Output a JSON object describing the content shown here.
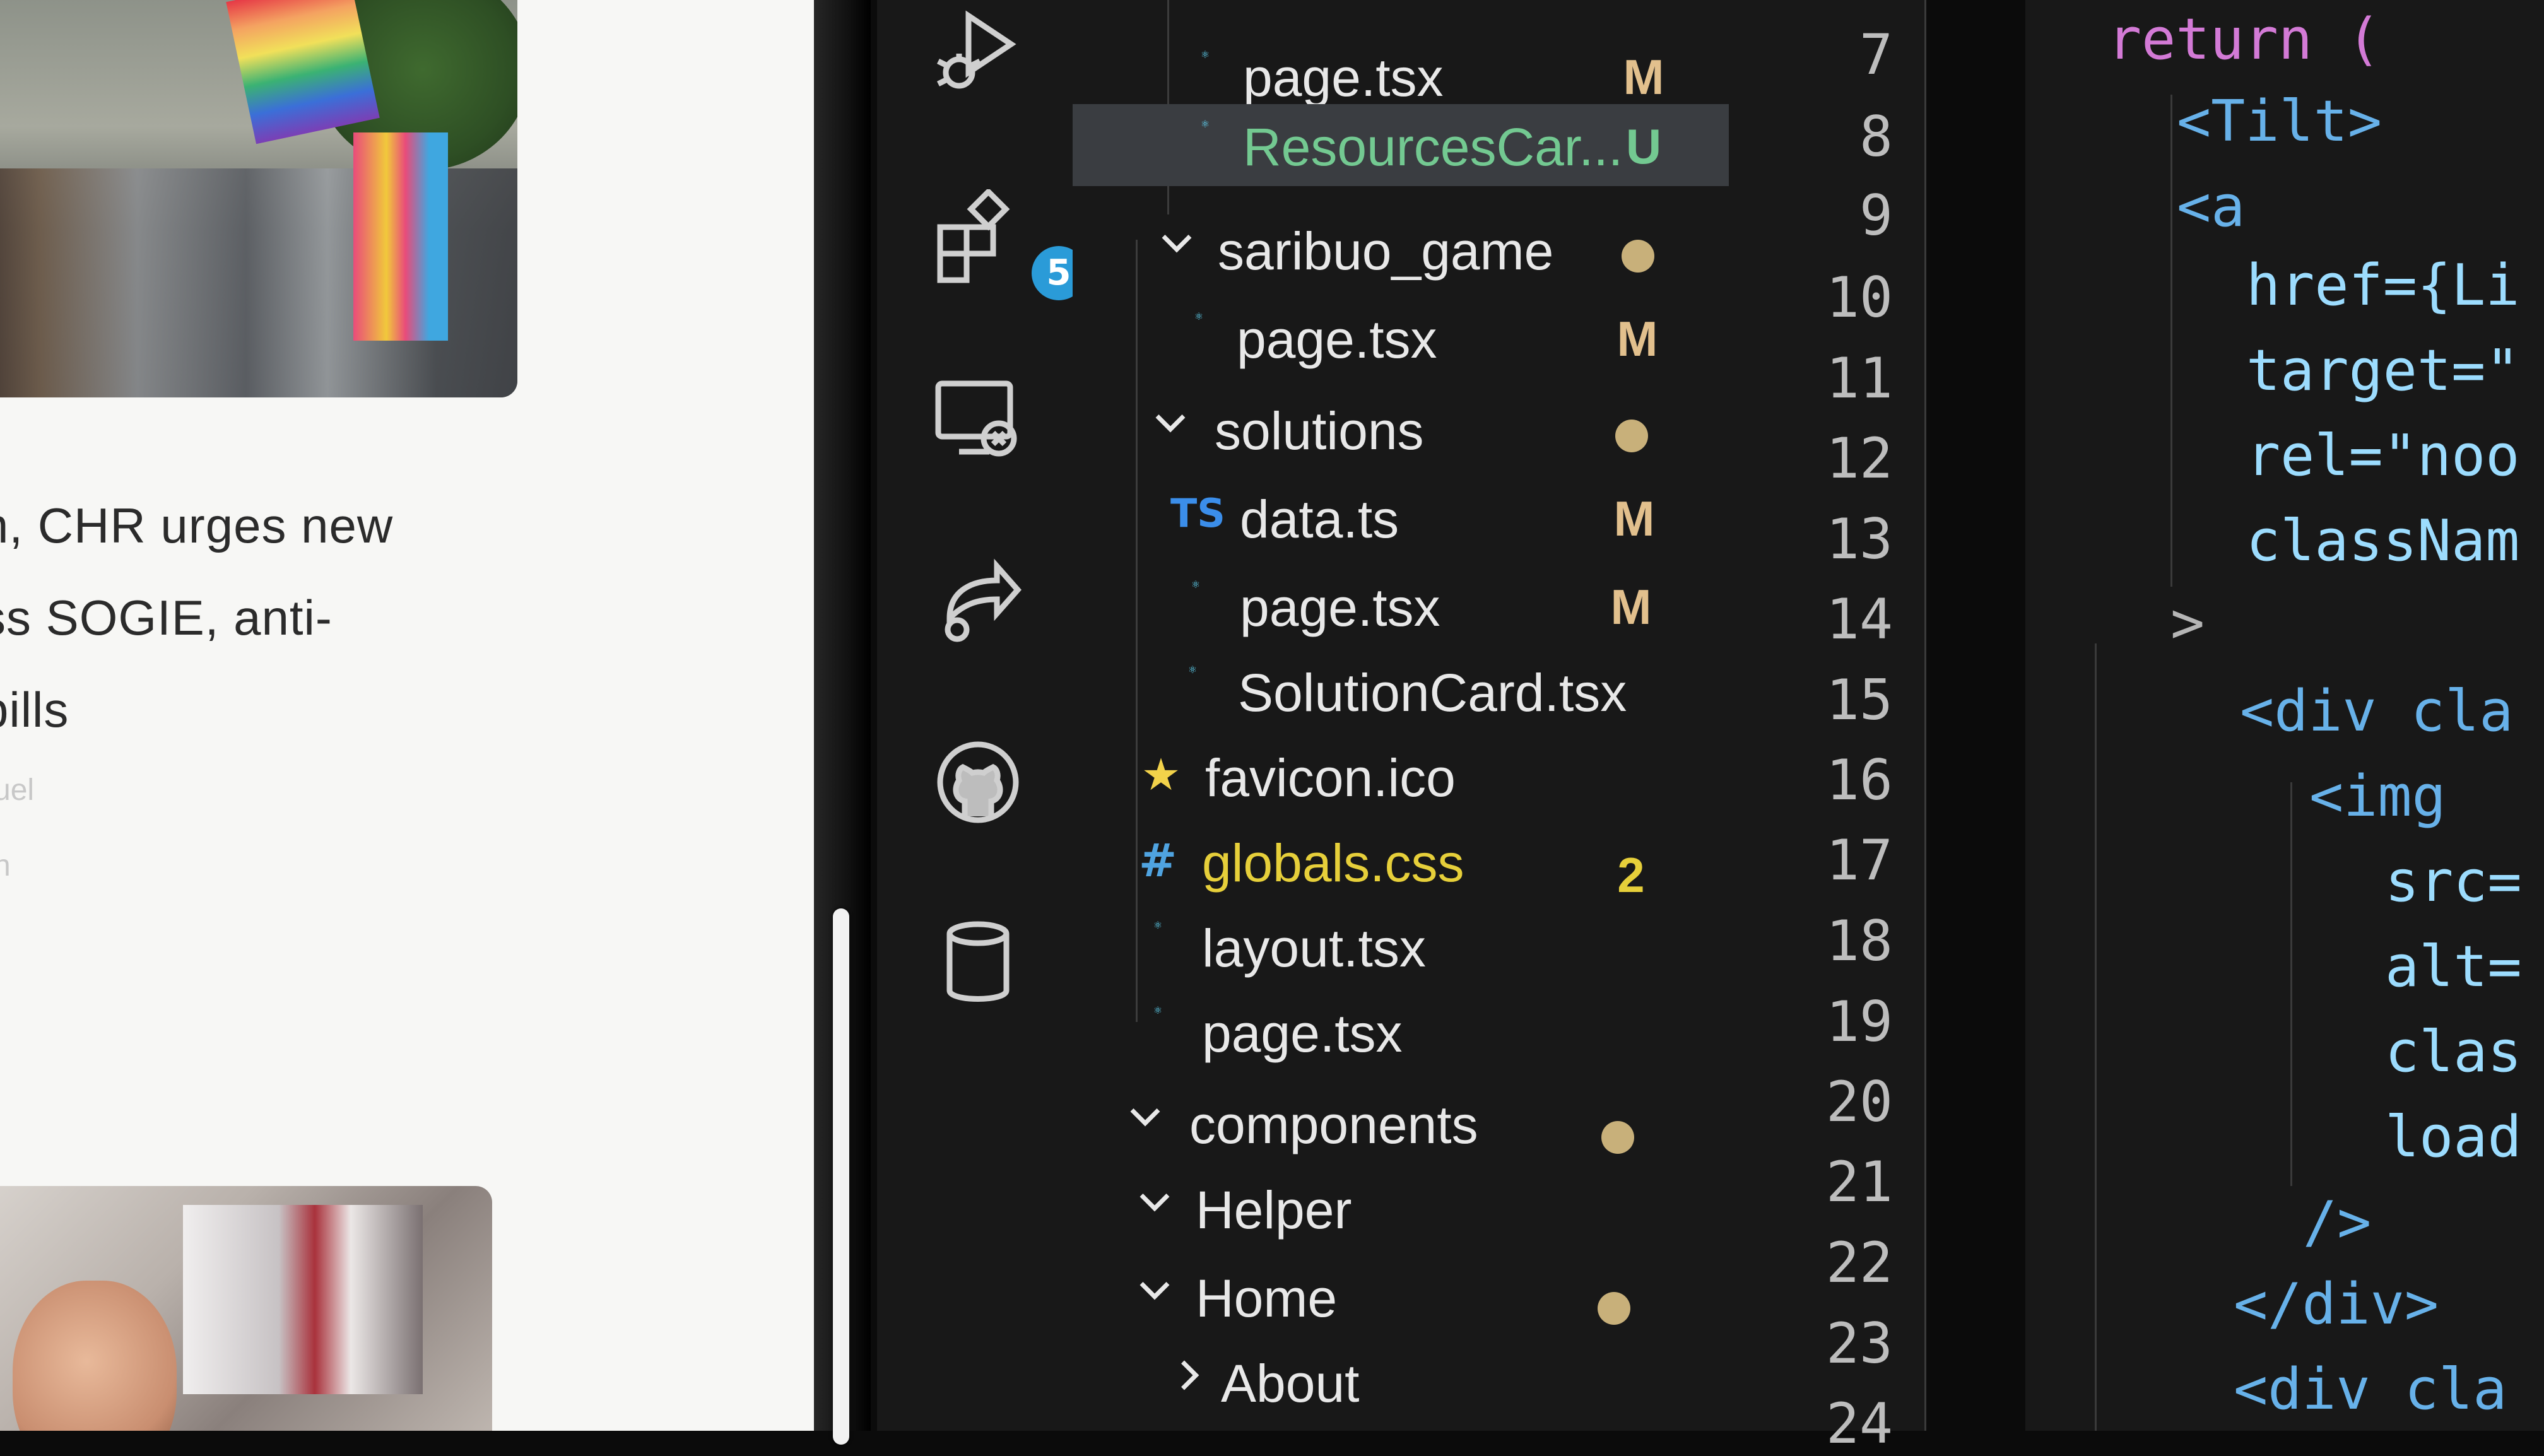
{
  "browser": {
    "headline_lines": [
      "n, CHR urges new",
      "ss SOGIE, anti-",
      "bills"
    ],
    "meta_1": "uel",
    "meta_2": "n"
  },
  "activity_bar": {
    "items": [
      {
        "name": "run-debug-icon"
      },
      {
        "name": "extensions-icon",
        "badge": "5"
      },
      {
        "name": "remote-explorer-icon"
      },
      {
        "name": "live-share-icon"
      },
      {
        "name": "github-icon"
      },
      {
        "name": "database-icon"
      }
    ]
  },
  "explorer": {
    "rows": [
      {
        "label": "page.tsx",
        "icon": "react-icon",
        "status": "M"
      },
      {
        "label": "ResourcesCar...",
        "icon": "react-icon",
        "status": "U",
        "selected": true
      },
      {
        "label": "saribuo_game",
        "icon": "chevron-down-icon",
        "status": "dot"
      },
      {
        "label": "page.tsx",
        "icon": "react-icon",
        "status": "M"
      },
      {
        "label": "solutions",
        "icon": "chevron-down-icon",
        "status": "dot"
      },
      {
        "label": "data.ts",
        "icon": "typescript-icon",
        "icon_text": "TS",
        "status": "M"
      },
      {
        "label": "page.tsx",
        "icon": "react-icon",
        "status": "M"
      },
      {
        "label": "SolutionCard.tsx",
        "icon": "react-icon",
        "status": ""
      },
      {
        "label": "favicon.ico",
        "icon": "star-icon",
        "status": ""
      },
      {
        "label": "globals.css",
        "icon": "css-hash-icon",
        "icon_text": "#",
        "status": "2"
      },
      {
        "label": "layout.tsx",
        "icon": "react-icon",
        "status": ""
      },
      {
        "label": "page.tsx",
        "icon": "react-icon",
        "status": ""
      },
      {
        "label": "components",
        "icon": "chevron-down-icon",
        "status": "dot"
      },
      {
        "label": "Helper",
        "icon": "chevron-down-icon",
        "status": ""
      },
      {
        "label": "Home",
        "icon": "chevron-down-icon",
        "status": "dot"
      },
      {
        "label": "About",
        "icon": "chevron-right-icon",
        "status": ""
      }
    ],
    "colors": {
      "modified": "#e2c08d",
      "untracked": "#73c991",
      "warning": "#cca700",
      "react": "#61dafb",
      "ts": "#3b8eea"
    }
  },
  "editor": {
    "line_numbers": [
      "7",
      "8",
      "9",
      "10",
      "11",
      "12",
      "13",
      "14",
      "15",
      "16",
      "17",
      "18",
      "19",
      "20",
      "21",
      "22",
      "23",
      "24"
    ],
    "lines": [
      {
        "text": "return ("
      },
      {
        "text": "<Tilt>"
      },
      {
        "text": "<a"
      },
      {
        "text": "href={Li"
      },
      {
        "text": "target=\""
      },
      {
        "text": "rel=\"noo"
      },
      {
        "text": "classNam"
      },
      {
        "text": ">"
      },
      {
        "text": "<div cla"
      },
      {
        "text": "<img"
      },
      {
        "text": "src="
      },
      {
        "text": "alt="
      },
      {
        "text": "clas"
      },
      {
        "text": "load"
      },
      {
        "text": "/>"
      },
      {
        "text": "</div>"
      },
      {
        "text": "<div cla"
      }
    ]
  }
}
